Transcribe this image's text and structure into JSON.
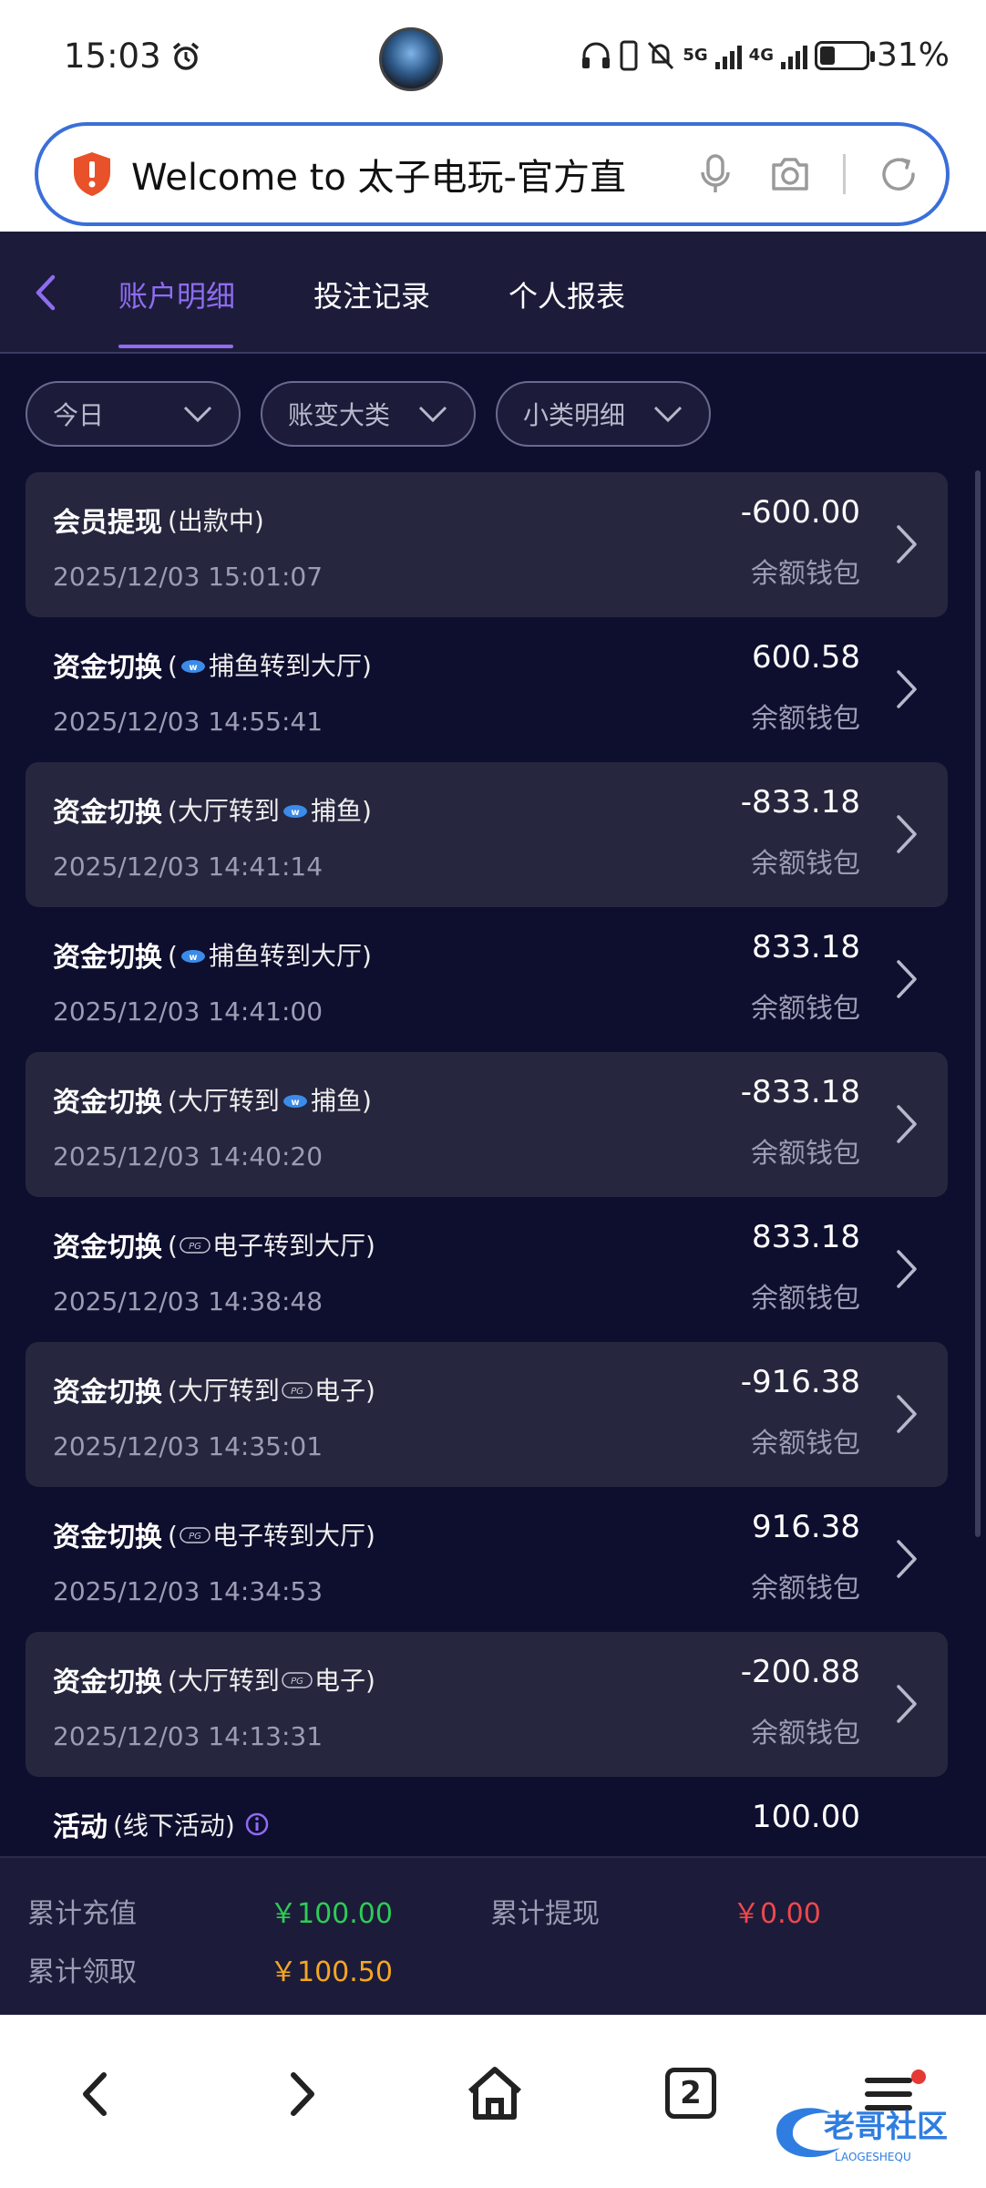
{
  "status_bar": {
    "time": "15:03",
    "net_5g": "5G",
    "net_4g": "4G",
    "battery": "31%",
    "battery_level": 0.31
  },
  "browser": {
    "url_text": "Welcome to 太子电玩-官方直"
  },
  "tabs": [
    {
      "label": "账户明细",
      "active": true
    },
    {
      "label": "投注记录",
      "active": false
    },
    {
      "label": "个人报表",
      "active": false
    }
  ],
  "filters": [
    {
      "label": "今日"
    },
    {
      "label": "账变大类"
    },
    {
      "label": "小类明细"
    }
  ],
  "records": [
    {
      "title": "会员提现",
      "detail_before": "(出款中)",
      "logo": "",
      "detail_after": "",
      "time": "2025/12/03 15:01:07",
      "amount": "-600.00",
      "wallet": "余额钱包"
    },
    {
      "title": "资金切换",
      "detail_before": "(",
      "logo": "fish",
      "detail_after": "捕鱼转到大厅)",
      "time": "2025/12/03 14:55:41",
      "amount": "600.58",
      "wallet": "余额钱包"
    },
    {
      "title": "资金切换",
      "detail_before": "(大厅转到",
      "logo": "fish",
      "detail_after": "捕鱼)",
      "time": "2025/12/03 14:41:14",
      "amount": "-833.18",
      "wallet": "余额钱包"
    },
    {
      "title": "资金切换",
      "detail_before": "(",
      "logo": "fish",
      "detail_after": "捕鱼转到大厅)",
      "time": "2025/12/03 14:41:00",
      "amount": "833.18",
      "wallet": "余额钱包"
    },
    {
      "title": "资金切换",
      "detail_before": "(大厅转到",
      "logo": "fish",
      "detail_after": "捕鱼)",
      "time": "2025/12/03 14:40:20",
      "amount": "-833.18",
      "wallet": "余额钱包"
    },
    {
      "title": "资金切换",
      "detail_before": "(",
      "logo": "pg",
      "detail_after": "电子转到大厅)",
      "time": "2025/12/03 14:38:48",
      "amount": "833.18",
      "wallet": "余额钱包"
    },
    {
      "title": "资金切换",
      "detail_before": "(大厅转到",
      "logo": "pg",
      "detail_after": "电子)",
      "time": "2025/12/03 14:35:01",
      "amount": "-916.38",
      "wallet": "余额钱包"
    },
    {
      "title": "资金切换",
      "detail_before": "(",
      "logo": "pg",
      "detail_after": "电子转到大厅)",
      "time": "2025/12/03 14:34:53",
      "amount": "916.38",
      "wallet": "余额钱包"
    },
    {
      "title": "资金切换",
      "detail_before": "(大厅转到",
      "logo": "pg",
      "detail_after": "电子)",
      "time": "2025/12/03 14:13:31",
      "amount": "-200.88",
      "wallet": "余额钱包"
    },
    {
      "title": "活动",
      "detail_before": "(线下活动)",
      "logo": "",
      "detail_after": "",
      "time": "",
      "amount": "100.00",
      "wallet": "",
      "info": true
    }
  ],
  "summary": {
    "recharge_label": "累计充值",
    "recharge_value": "￥100.00",
    "withdraw_label": "累计提现",
    "withdraw_value": "￥0.00",
    "claim_label": "累计领取",
    "claim_value": "￥100.50"
  },
  "bottom_nav": {
    "tab_count": "2"
  },
  "watermark": {
    "text": "老哥社区",
    "sub": "LAOGESHEQU"
  },
  "colors": {
    "accent": "#8f6cf2",
    "background": "#0e0e2e",
    "recharge": "#2ecc55",
    "withdraw": "#f0484c",
    "claim": "#f5a623"
  }
}
